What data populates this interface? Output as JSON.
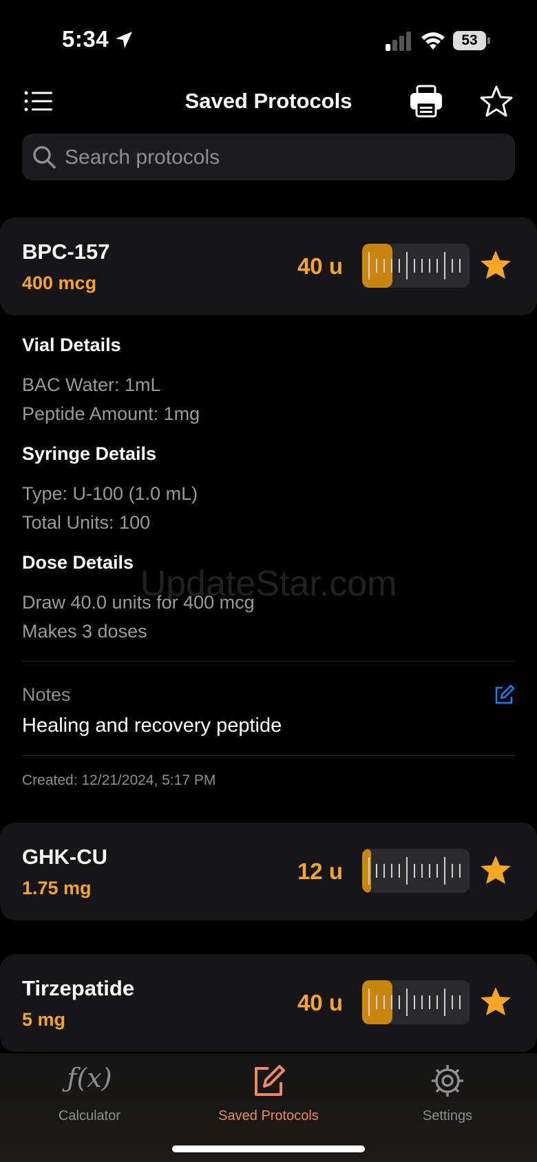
{
  "status_bar": {
    "time": "5:34",
    "battery": "53"
  },
  "nav": {
    "title": "Saved Protocols"
  },
  "search": {
    "placeholder": "Search protocols"
  },
  "protocols": [
    {
      "name": "BPC-157",
      "dose": "400 mcg",
      "units": "40 u",
      "fill_fraction": 0.4,
      "favorite": true
    },
    {
      "name": "GHK-CU",
      "dose": "1.75 mg",
      "units": "12 u",
      "fill_fraction": 0.12,
      "favorite": true
    },
    {
      "name": "Tirzepatide",
      "dose": "5 mg",
      "units": "40 u",
      "fill_fraction": 0.4,
      "favorite": true
    }
  ],
  "details": {
    "vial_heading": "Vial Details",
    "bac_water": "BAC Water: 1mL",
    "peptide_amount": "Peptide Amount: 1mg",
    "syringe_heading": "Syringe Details",
    "syringe_type": "Type: U-100 (1.0 mL)",
    "total_units": "Total Units: 100",
    "dose_heading": "Dose Details",
    "draw": "Draw 40.0 units for 400 mcg",
    "makes": "Makes 3 doses",
    "notes_label": "Notes",
    "notes_text": "Healing and recovery peptide",
    "created": "Created: 12/21/2024, 5:17 PM"
  },
  "watermark": "UpdateStar.com",
  "tabs": [
    {
      "label": "Calculator",
      "active": false
    },
    {
      "label": "Saved Protocols",
      "active": true
    },
    {
      "label": "Settings",
      "active": false
    }
  ],
  "colors": {
    "accent": "#f5a623",
    "tab_active": "#f08a5d",
    "edit_blue": "#0a84ff"
  }
}
